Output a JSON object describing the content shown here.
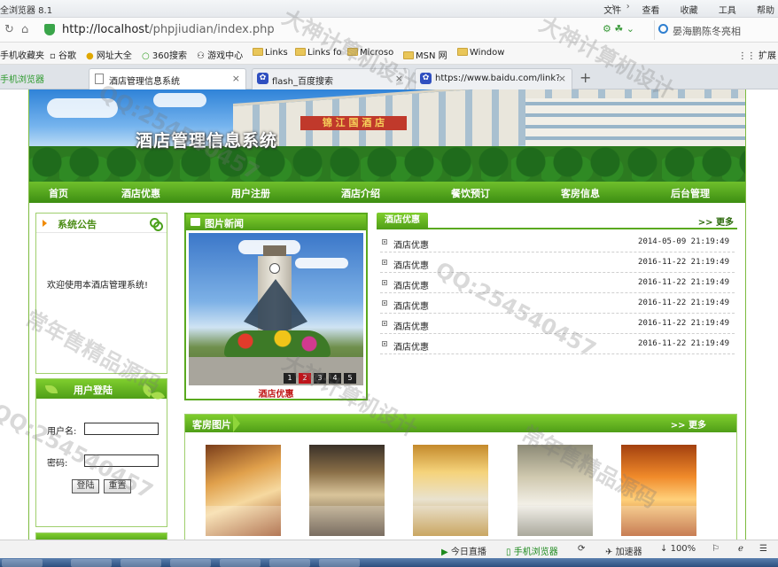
{
  "browser": {
    "app_title": "全浏览器 8.1",
    "menu": [
      "文件",
      "查看",
      "收藏",
      "工具",
      "帮助"
    ],
    "url_host": "http://localhost",
    "url_path": "/phpjiudian/index.php",
    "search_text": "晏海鹏陈冬亮相",
    "favorites": [
      "手机收藏夹",
      "谷歌",
      "网址大全",
      "360搜索",
      "游戏中心",
      "Links",
      "Links fo",
      "Microso",
      "MSN 网",
      "Window"
    ],
    "extension_label": "扩展",
    "mobile_browser_label": "手机浏览器",
    "tabs": [
      {
        "title": "酒店管理信息系统",
        "active": true
      },
      {
        "title": "flash_百度搜索",
        "active": false
      },
      {
        "title": "https://www.baidu.com/link?...",
        "active": false
      }
    ]
  },
  "site": {
    "title": "酒店管理信息系统",
    "banner_sign": "锦 江 国 酒 店",
    "nav": [
      "首页",
      "酒店优惠",
      "用户注册",
      "酒店介绍",
      "餐饮预订",
      "客房信息",
      "后台管理"
    ],
    "notice": {
      "title": "系统公告",
      "text": "欢迎使用本酒店管理系统!"
    },
    "login": {
      "title": "用户登陆",
      "username_label": "用户名:",
      "password_label": "密码:",
      "login_button": "登陆",
      "reset_button": "重置"
    },
    "photo_news": {
      "title": "图片新闻",
      "caption": "酒店优惠",
      "pages": [
        "1",
        "2",
        "3",
        "4",
        "5"
      ],
      "current_page": 2
    },
    "promotions": {
      "tab": "酒店优惠",
      "more": ">> 更多",
      "items": [
        {
          "title": "酒店优惠",
          "date": "2014-05-09 21:19:49"
        },
        {
          "title": "酒店优惠",
          "date": "2016-11-22 21:19:49"
        },
        {
          "title": "酒店优惠",
          "date": "2016-11-22 21:19:49"
        },
        {
          "title": "酒店优惠",
          "date": "2016-11-22 21:19:49"
        },
        {
          "title": "酒店优惠",
          "date": "2016-11-22 21:19:49"
        },
        {
          "title": "酒店优惠",
          "date": "2016-11-22 21:19:49"
        }
      ]
    },
    "rooms": {
      "title": "客房图片",
      "more": ">> 更多"
    }
  },
  "statusbar": {
    "live": "今日直播",
    "mobile": "手机浏览器",
    "accelerator": "加速器",
    "zoom": "100%"
  },
  "watermark": {
    "lines": [
      "大神计算机设计",
      "QQ:254540457",
      "常年售精品源码"
    ]
  }
}
